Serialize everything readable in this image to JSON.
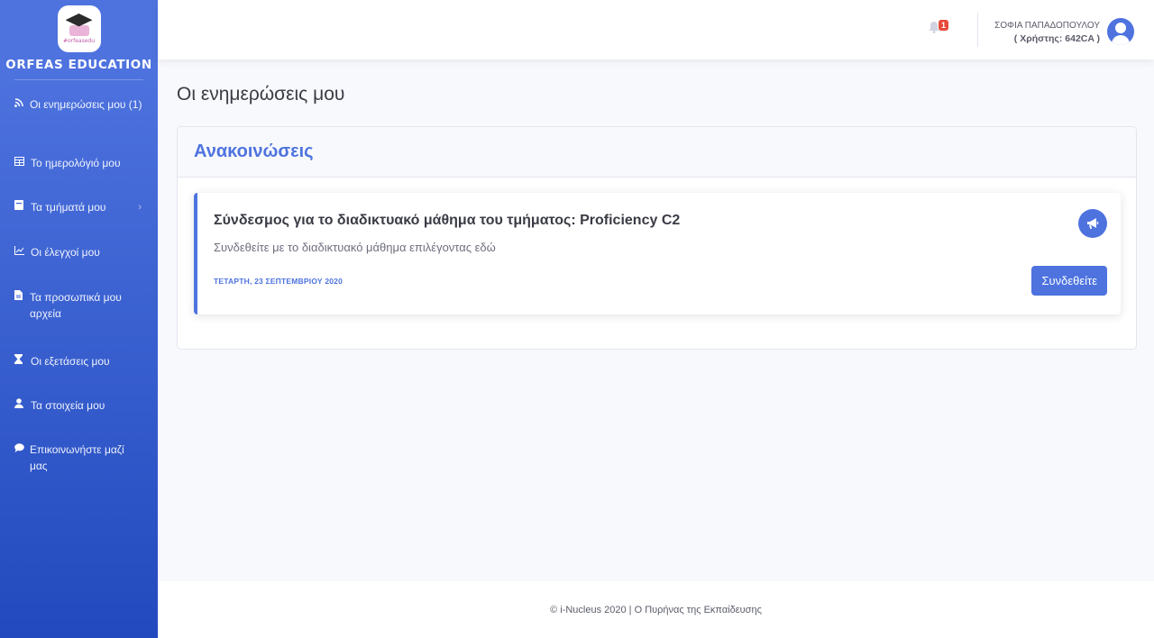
{
  "brand": {
    "name": "ORFEAS EDUCATION",
    "logo_text": "#orfeasedu"
  },
  "sidebar": {
    "items": [
      {
        "label": "Οι ενημερώσεις μου (1)",
        "icon": "rss-icon"
      },
      {
        "label": "Το ημερολόγιό μου",
        "icon": "calendar-icon"
      },
      {
        "label": "Τα τμήματά μου",
        "icon": "book-icon",
        "has_submenu": true
      },
      {
        "label": "Οι έλεγχοί μου",
        "icon": "chart-line-icon"
      },
      {
        "label": "Τα προσωπικά μου αρχεία",
        "icon": "file-icon"
      },
      {
        "label": "Οι εξετάσεις μου",
        "icon": "hourglass-icon"
      },
      {
        "label": "Τα στοιχεία μου",
        "icon": "user-icon"
      },
      {
        "label": "Επικοινωνήστε μαζί μας",
        "icon": "comment-icon"
      }
    ]
  },
  "topbar": {
    "notification_count": "1",
    "user_name": "ΣΟΦΙΑ ΠΑΠΑΔΟΠΟΥΛΟΥ",
    "user_id": "( Χρήστης: 642CA )"
  },
  "main": {
    "page_title": "Οι ενημερώσεις μου",
    "card_title": "Ανακοινώσεις",
    "announcement": {
      "title": "Σύνδεσμος για το διαδικτυακό μάθημα του τμήματος: Proficiency C2",
      "subtitle": "Συνδεθείτε με το διαδικτυακό μάθημα επιλέγοντας εδώ",
      "date": "ΤΕΤΑΡΤΗ, 23 ΣΕΠΤΕΜΒΡΙΟΥ 2020",
      "button_label": "Συνδεθείτε",
      "icon": "bullhorn-icon"
    }
  },
  "footer": {
    "text": "© i-Nucleus 2020 | Ο Πυρήνας της Εκπαίδευσης"
  },
  "colors": {
    "primary": "#4e73df",
    "sidebar_end": "#224abe",
    "danger": "#e74a3b"
  }
}
